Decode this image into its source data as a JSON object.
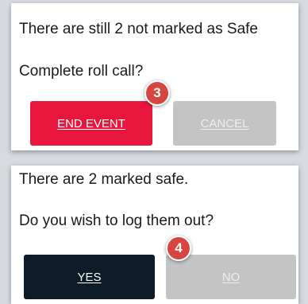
{
  "end_event_dialog": {
    "message": "There are still 2 not marked as Safe",
    "question": "Complete roll call?",
    "end_event_label": "END EVENT",
    "cancel_label": "CANCEL",
    "step_badge": "3"
  },
  "logout_dialog": {
    "message": "There are 2 marked safe.",
    "question": "Do you wish to log them out?",
    "yes_label": "YES",
    "no_label": "NO",
    "step_badge": "4"
  },
  "colors": {
    "end_event_button": "#e8163c",
    "yes_button": "#0d1c28",
    "disabled_button": "#c4c4c4",
    "step_badge": "#d6453f"
  }
}
